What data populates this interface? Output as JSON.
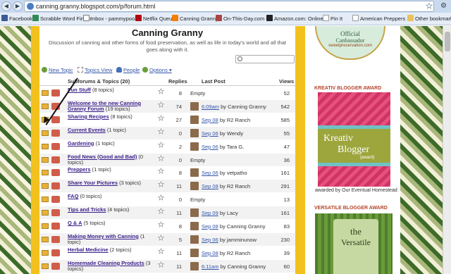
{
  "browser": {
    "url": "canning.granny.blogspot.com/p/forum.html",
    "bookmarks": [
      "Facebook",
      "Scrabble Word Finder",
      "Inbox - pammypoo3...",
      "Netflix Queue",
      "Canning Granny",
      "On-This-Day.com - ...",
      "Amazon.com: Online...",
      "Pin It",
      "American Preppers ...",
      "Other bookmarks"
    ]
  },
  "forum": {
    "title": "Canning Granny",
    "description": "Discussion of canning and other forms of food preservation, as well as life in today's world and all that goes along with it.",
    "tools": {
      "new_topic": "New Topic",
      "topics_view": "Topics View",
      "people": "People",
      "options": "Options"
    },
    "columns": {
      "subforums": "Subforums & Topics (20)",
      "replies": "Replies",
      "last_post": "Last Post",
      "views": "Views"
    },
    "rows": [
      {
        "name": "Fun Stuff",
        "count": "(8 topics)",
        "replies": "8",
        "last_date": "",
        "last_by": "Empty",
        "views": "52"
      },
      {
        "name": "Welcome to the new Canning Granny Forum",
        "count": "(19 topics)",
        "replies": "74",
        "last_date": "6:09am",
        "last_by": "by Canning Granny",
        "views": "542"
      },
      {
        "name": "Sharing Recipes",
        "count": "(8 topics)",
        "replies": "27",
        "last_date": "Sep 08",
        "last_by": "by R2 Ranch",
        "views": "585"
      },
      {
        "name": "Current Events",
        "count": "(1 topic)",
        "replies": "0",
        "last_date": "Sep 06",
        "last_by": "by Wendy",
        "views": "55"
      },
      {
        "name": "Gardening",
        "count": "(1 topic)",
        "replies": "2",
        "last_date": "Sep 06",
        "last_by": "by Tara G.",
        "views": "47"
      },
      {
        "name": "Food News (Good and Bad)",
        "count": "(0 topics)",
        "replies": "0",
        "last_date": "",
        "last_by": "Empty",
        "views": "36"
      },
      {
        "name": "Preppers",
        "count": "(1 topic)",
        "replies": "8",
        "last_date": "Sep 06",
        "last_by": "by vetpatho",
        "views": "161"
      },
      {
        "name": "Share Your Pictures",
        "count": "(3 topics)",
        "replies": "11",
        "last_date": "Sep 08",
        "last_by": "by R2 Ranch",
        "views": "291"
      },
      {
        "name": "FAQ",
        "count": "(0 topics)",
        "replies": "0",
        "last_date": "",
        "last_by": "Empty",
        "views": "13"
      },
      {
        "name": "Tips and Tricks",
        "count": "(4 topics)",
        "replies": "11",
        "last_date": "Sep 09",
        "last_by": "by Lacy",
        "views": "161"
      },
      {
        "name": "Q & A",
        "count": "(5 topics)",
        "replies": "8",
        "last_date": "Sep 08",
        "last_by": "by Canning Granny",
        "views": "83"
      },
      {
        "name": "Making Money with Canning",
        "count": "(1 topic)",
        "replies": "5",
        "last_date": "Sep 06",
        "last_by": "by jamminunow",
        "views": "230"
      },
      {
        "name": "Herbal Medicine",
        "count": "(2 topics)",
        "replies": "11",
        "last_date": "Sep 08",
        "last_by": "by R2 Ranch",
        "views": "39"
      },
      {
        "name": "Homemade Cleaning Products",
        "count": "(3 topics)",
        "replies": "11",
        "last_date": "6:11am",
        "last_by": "by Canning Granny",
        "views": "60"
      }
    ]
  },
  "sidebar": {
    "badge_line1": "Official",
    "badge_line2": "Canbassador",
    "badge_line3": "sweetpreservation.com",
    "kreativ_heading": "KREATIV BLOGGER AWARD",
    "kreativ_text1": "Kreativ",
    "kreativ_text2": "Blogger",
    "kreativ_text3": "{award}",
    "kreativ_caption": "awarded by Our Eventual Homestead",
    "versatile_heading": "VERSATILE BLOGGER AWARD",
    "versatile_text1": "the",
    "versatile_text2": "Versatile"
  }
}
